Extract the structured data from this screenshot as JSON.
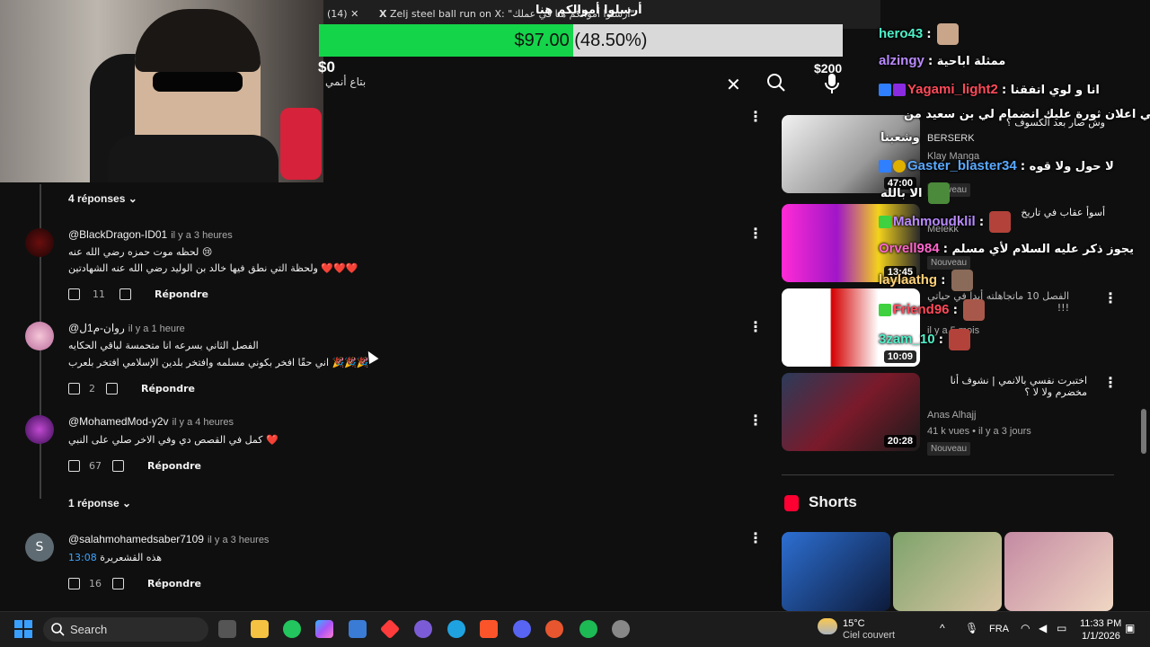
{
  "browser": {
    "tab1": "(14)",
    "tab2": "Zelj steel ball run on X: \"أرسلوا أموالكم هنا في عملك\""
  },
  "donation": {
    "title": "أرسلوا أموالكم هنا",
    "current": "$97.00",
    "percent_label": "(48.50%)",
    "progress": 0.485,
    "min": "$0",
    "max": "$200",
    "fill_color": "#14d44a"
  },
  "search": {
    "query": "بتاع أنمي"
  },
  "comments": {
    "replies_top": "4 réponses",
    "items": [
      {
        "handle": "@BlackDragon-ID01",
        "time": "il y a 3 heures",
        "line1": "لحظه موت حمزه رضي الله عنه 😢",
        "line2": "ولحظة التي نطق فيها خالد بن الوليد رضي الله عنه الشهادتين ❤️❤️❤️",
        "likes": "11",
        "reply": "Répondre"
      },
      {
        "handle": "@روان-م1ل",
        "time": "il y a 1 heure",
        "line1": "الفصل الثاني بسرعه انا متحمسة لباقي الحكايه",
        "line2": "اني حقًا افخر بكوني مسلمه وافتخر بلدين الإسلامي افتخر بلعرب 🎉🎉🎉",
        "likes": "2",
        "reply": "Répondre"
      },
      {
        "handle": "@MohamedMod-y2v",
        "time": "il y a 4 heures",
        "line1": "كمل في القصص دي وفي الاخر صلي على النبي ❤️",
        "likes": "67",
        "reply": "Répondre"
      },
      {
        "handle": "@salahmohamedsaber7109",
        "time": "il y a 3 heures",
        "line1": "هذه القشعريرة",
        "timestamp": "13:08",
        "likes": "16",
        "reply": "Répondre"
      }
    ],
    "replies_mid": "1 réponse"
  },
  "sidebar": {
    "videos": [
      {
        "title": "وش صار بعد الكسوف ؟",
        "channel": "BERSERK",
        "meta": "Klay Manga",
        "duration": "47:00",
        "badge": "Nouveau"
      },
      {
        "title": "أسوأ عقاب في تاريخ",
        "channel": "Melekk",
        "meta": "",
        "duration": "13:45",
        "badge": "Nouveau"
      },
      {
        "title": "الفصل 10 ماتجاهلته أبدا في حياتي !!!",
        "channel": "",
        "meta": "il y a 5 mois",
        "duration": "10:09",
        "badge": ""
      },
      {
        "title": "اختبرت نفسي بالانمي | نشوف أنا مخضرم ولا لا ؟",
        "channel": "Anas Alhajj",
        "meta": "41 k vues • il y a 3 jours",
        "duration": "20:28",
        "badge": "Nouveau"
      }
    ],
    "shorts_title": "Shorts"
  },
  "chat": {
    "messages": [
      {
        "user": "hero43",
        "color": "#4ff0c8",
        "text": ":"
      },
      {
        "user": "alzingy",
        "color": "#b98bff",
        "text": ": ممثلة اباحية"
      },
      {
        "user": "Yagami_light2",
        "color": "#ff4a5a",
        "text": ": انا و لوي اتفقنا"
      },
      {
        "user": "",
        "color": "#ffffff",
        "text": "خاص بي اعلان ثورة عليك انضمام لي بن سعيد من"
      },
      {
        "user": "",
        "color": "#ffffff",
        "text": "وشعبنا"
      },
      {
        "user": "Gaster_blaster34",
        "color": "#5aa9ff",
        "text": ": لا حول ولا قوه"
      },
      {
        "user": "",
        "color": "#ffffff",
        "text": "الا بالله"
      },
      {
        "user": "Mahmoudklil",
        "color": "#b98bff",
        "text": ":"
      },
      {
        "user": "Orvell984",
        "color": "#ff66cc",
        "text": ": يجوز ذكر عليه السلام لأي مسلم"
      },
      {
        "user": "laylaathg",
        "color": "#ffd27a",
        "text": ":"
      },
      {
        "user": "Friend96",
        "color": "#ff4a5a",
        "text": ":"
      },
      {
        "user": "3zam_10",
        "color": "#4ff0c8",
        "text": ":"
      }
    ]
  },
  "taskbar": {
    "search": "Search",
    "weather_temp": "15°C",
    "weather_desc": "Ciel couvert",
    "lang": "FRA",
    "time": "11:33 PM",
    "date": "1/1/2026"
  }
}
